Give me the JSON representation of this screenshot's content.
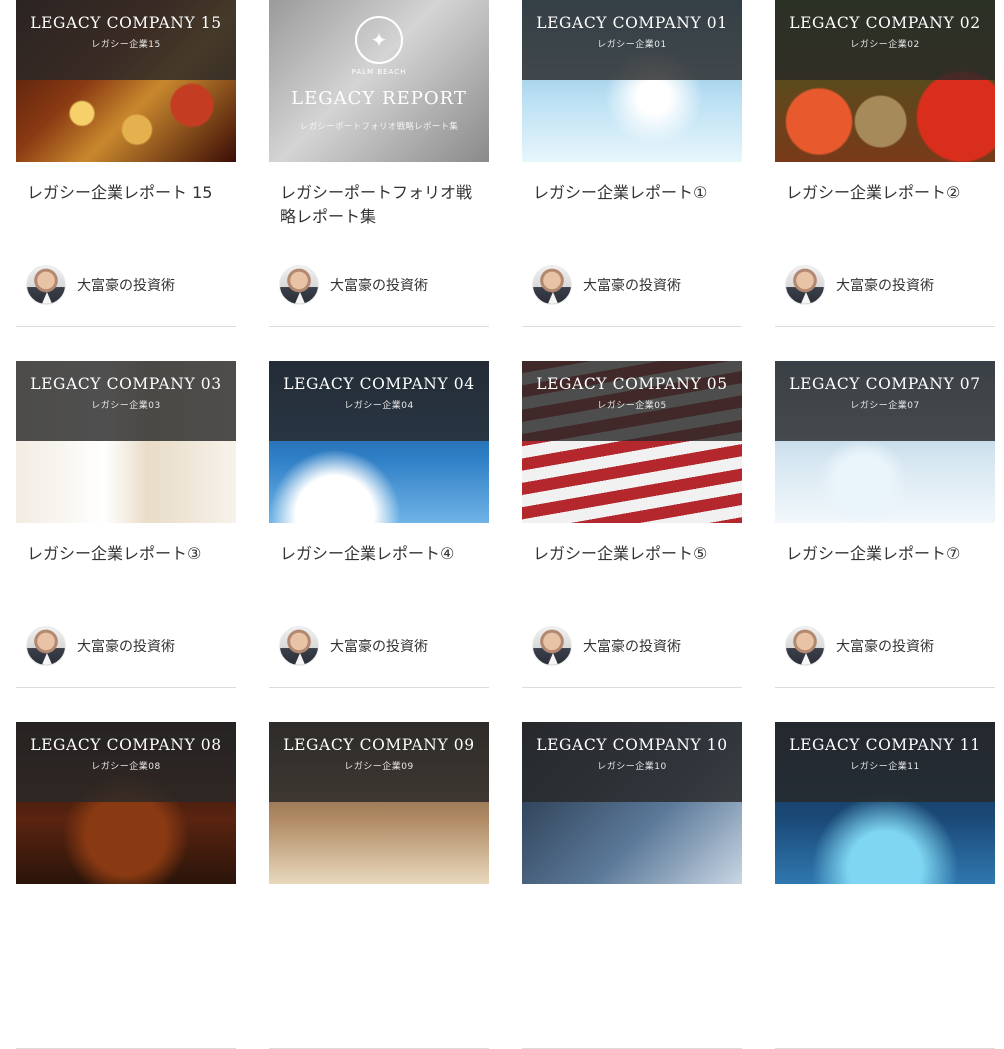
{
  "author": {
    "name": "大富豪の投資術",
    "avatar_icon": "person-avatar"
  },
  "report_card": {
    "emblem_icon": "laurel-crest-icon",
    "emblem_caption": "PALM BEACH",
    "thumb_title": "LEGACY REPORT",
    "thumb_subtitle": "レガシーポートフォリオ戦略レポート集",
    "title": "レガシーポートフォリオ戦略レポート集"
  },
  "cards": [
    {
      "thumb_title": "LEGACY COMPANY 15",
      "thumb_subtitle": "レガシー企業15",
      "title": "レガシー企業レポート 15",
      "bg": "bg-15"
    },
    {
      "type": "report"
    },
    {
      "thumb_title": "LEGACY COMPANY 01",
      "thumb_subtitle": "レガシー企業01",
      "title": "レガシー企業レポート①",
      "bg": "bg-01"
    },
    {
      "thumb_title": "LEGACY COMPANY 02",
      "thumb_subtitle": "レガシー企業02",
      "title": "レガシー企業レポート②",
      "bg": "bg-02"
    },
    {
      "thumb_title": "LEGACY COMPANY 03",
      "thumb_subtitle": "レガシー企業03",
      "title": "レガシー企業レポート③",
      "bg": "bg-03"
    },
    {
      "thumb_title": "LEGACY COMPANY 04",
      "thumb_subtitle": "レガシー企業04",
      "title": "レガシー企業レポート④",
      "bg": "bg-04"
    },
    {
      "thumb_title": "LEGACY COMPANY 05",
      "thumb_subtitle": "レガシー企業05",
      "title": "レガシー企業レポート⑤",
      "bg": "bg-05"
    },
    {
      "thumb_title": "LEGACY COMPANY 07",
      "thumb_subtitle": "レガシー企業07",
      "title": "レガシー企業レポート⑦",
      "bg": "bg-07"
    },
    {
      "thumb_title": "LEGACY COMPANY 08",
      "thumb_subtitle": "レガシー企業08",
      "title": "",
      "bg": "bg-08"
    },
    {
      "thumb_title": "LEGACY COMPANY 09",
      "thumb_subtitle": "レガシー企業09",
      "title": "",
      "bg": "bg-09"
    },
    {
      "thumb_title": "LEGACY COMPANY 10",
      "thumb_subtitle": "レガシー企業10",
      "title": "",
      "bg": "bg-10"
    },
    {
      "thumb_title": "LEGACY COMPANY 11",
      "thumb_subtitle": "レガシー企業11",
      "title": "",
      "bg": "bg-11"
    }
  ]
}
